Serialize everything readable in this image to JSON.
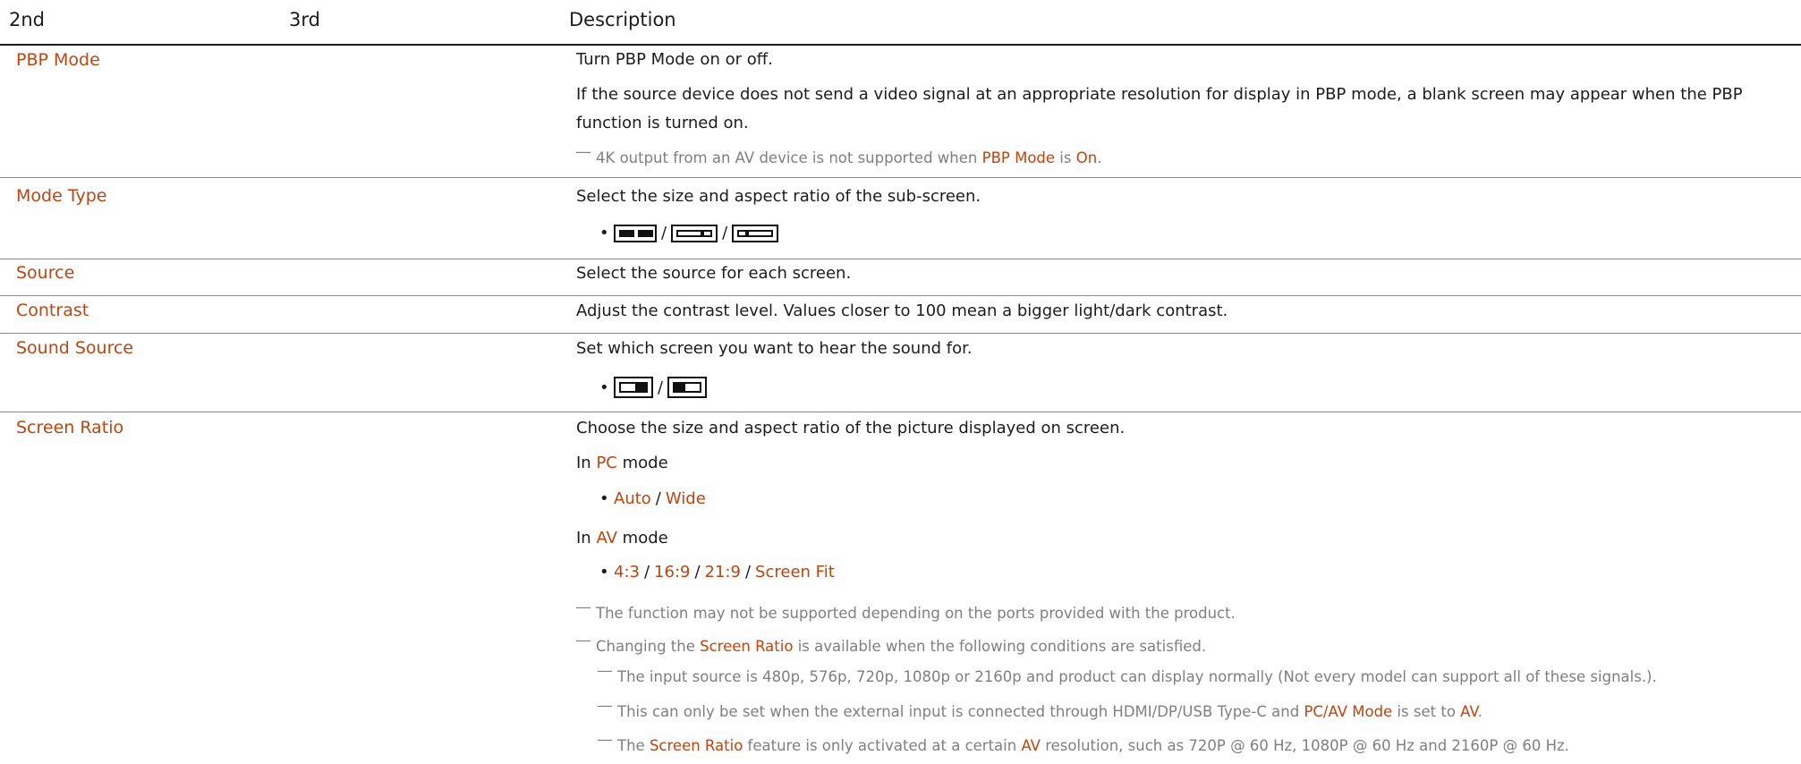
{
  "header": {
    "col1": "2nd",
    "col2": "3rd",
    "col3": "Description"
  },
  "rows": {
    "pbp": {
      "label": "PBP Mode",
      "desc1": "Turn PBP Mode on or off.",
      "desc2a": "If the source device does not send a video signal at an appropriate resolution for display in PBP mode, a blank screen may appear when the PBP",
      "desc2b": "function is turned on.",
      "note_pre": "4K output from an AV device is not supported when",
      "note_hl1": "PBP Mode",
      "note_mid": "is",
      "note_hl2": "On",
      "note_end": "."
    },
    "modetype": {
      "label": "Mode Type",
      "desc": "Select the size and aspect ratio of the sub-screen.",
      "sep": "/",
      "icons": [
        "pbp-two-filled-icon",
        "pbp-two-outline-icon",
        "pbp-small-left-icon"
      ]
    },
    "source": {
      "label": "Source",
      "desc": "Select the source for each screen."
    },
    "contrast": {
      "label": "Contrast",
      "desc": "Adjust the contrast level. Values closer to 100 mean a bigger light/dark contrast."
    },
    "sound": {
      "label": "Sound Source",
      "desc": "Set which screen you want to hear the sound for.",
      "sep": "/",
      "icons": [
        "sound-right-screen-icon",
        "sound-left-screen-icon"
      ]
    },
    "ratio": {
      "label": "Screen Ratio",
      "desc": "Choose the size and aspect ratio of the picture displayed on screen.",
      "pc_in": "In",
      "pc_hl": "PC",
      "pc_mode": "mode",
      "pc_opts": [
        "Auto",
        "Wide"
      ],
      "av_in": "In",
      "av_hl": "AV",
      "av_mode": "mode",
      "av_opts": [
        "4:3",
        "16:9",
        "21:9",
        "Screen Fit"
      ],
      "sep": "/",
      "note1": "The function may not be supported depending on the ports provided with the product.",
      "note2_pre": "Changing the",
      "note2_hl": "Screen Ratio",
      "note2_post": "is available when the following conditions are satisfied.",
      "sub1": "The input source is 480p, 576p, 720p, 1080p or 2160p and product can display normally (Not every model can support all of these signals.).",
      "sub2_pre": "This can only be set when the external input is connected through HDMI/DP/USB Type-C and",
      "sub2_hl1": "PC/AV Mode",
      "sub2_mid": "is set to",
      "sub2_hl2": "AV",
      "sub2_end": ".",
      "sub3_pre": "The",
      "sub3_hl1": "Screen Ratio",
      "sub3_mid": "feature is only activated at a certain",
      "sub3_hl2": "AV",
      "sub3_post": "resolution, such as 720P @ 60 Hz, 1080P @ 60 Hz and 2160P @ 60 Hz."
    }
  },
  "colors": {
    "accent": "#c1440e",
    "note": "#7f7f7f",
    "text": "#1c1c1c"
  },
  "note_marker": "―",
  "bullet": "•"
}
